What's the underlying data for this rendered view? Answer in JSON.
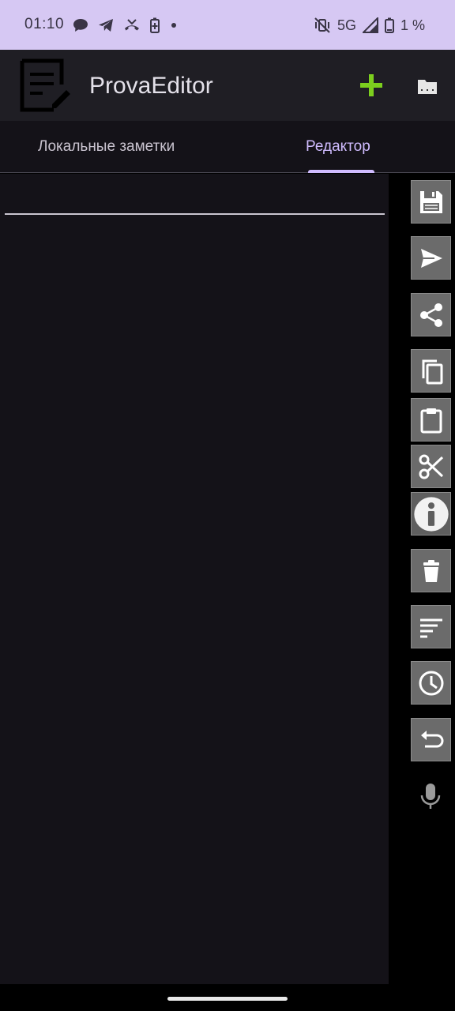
{
  "status_bar": {
    "time": "01:10",
    "network": "5G",
    "battery": "1 %",
    "left_icons": [
      "chat-icon",
      "telegram-icon",
      "missed-call-icon",
      "battery-saver-icon",
      "dot-icon"
    ],
    "right_icons": [
      "mute-vibrate-icon",
      "signal-icon",
      "battery-icon"
    ]
  },
  "app_bar": {
    "title": "ProvaEditor",
    "add_icon": "plus-icon",
    "add_color": "#7ccf1e",
    "folder_icon": "folder-icon"
  },
  "tabs": [
    {
      "label": "Локальные заметки",
      "active": false
    },
    {
      "label": "Редактор",
      "active": true
    }
  ],
  "accent_color": "#d0bcff",
  "editor": {
    "value": "",
    "placeholder": ""
  },
  "toolbar": [
    {
      "icon": "save-icon"
    },
    {
      "icon": "send-icon"
    },
    {
      "icon": "share-icon"
    },
    {
      "icon": "copy-icon"
    },
    {
      "icon": "paste-icon"
    },
    {
      "icon": "cut-icon"
    },
    {
      "icon": "info-icon"
    },
    {
      "icon": "delete-icon"
    },
    {
      "icon": "format-align-icon"
    },
    {
      "icon": "history-icon"
    },
    {
      "icon": "undo-icon"
    },
    {
      "icon": "microphone-icon"
    }
  ]
}
